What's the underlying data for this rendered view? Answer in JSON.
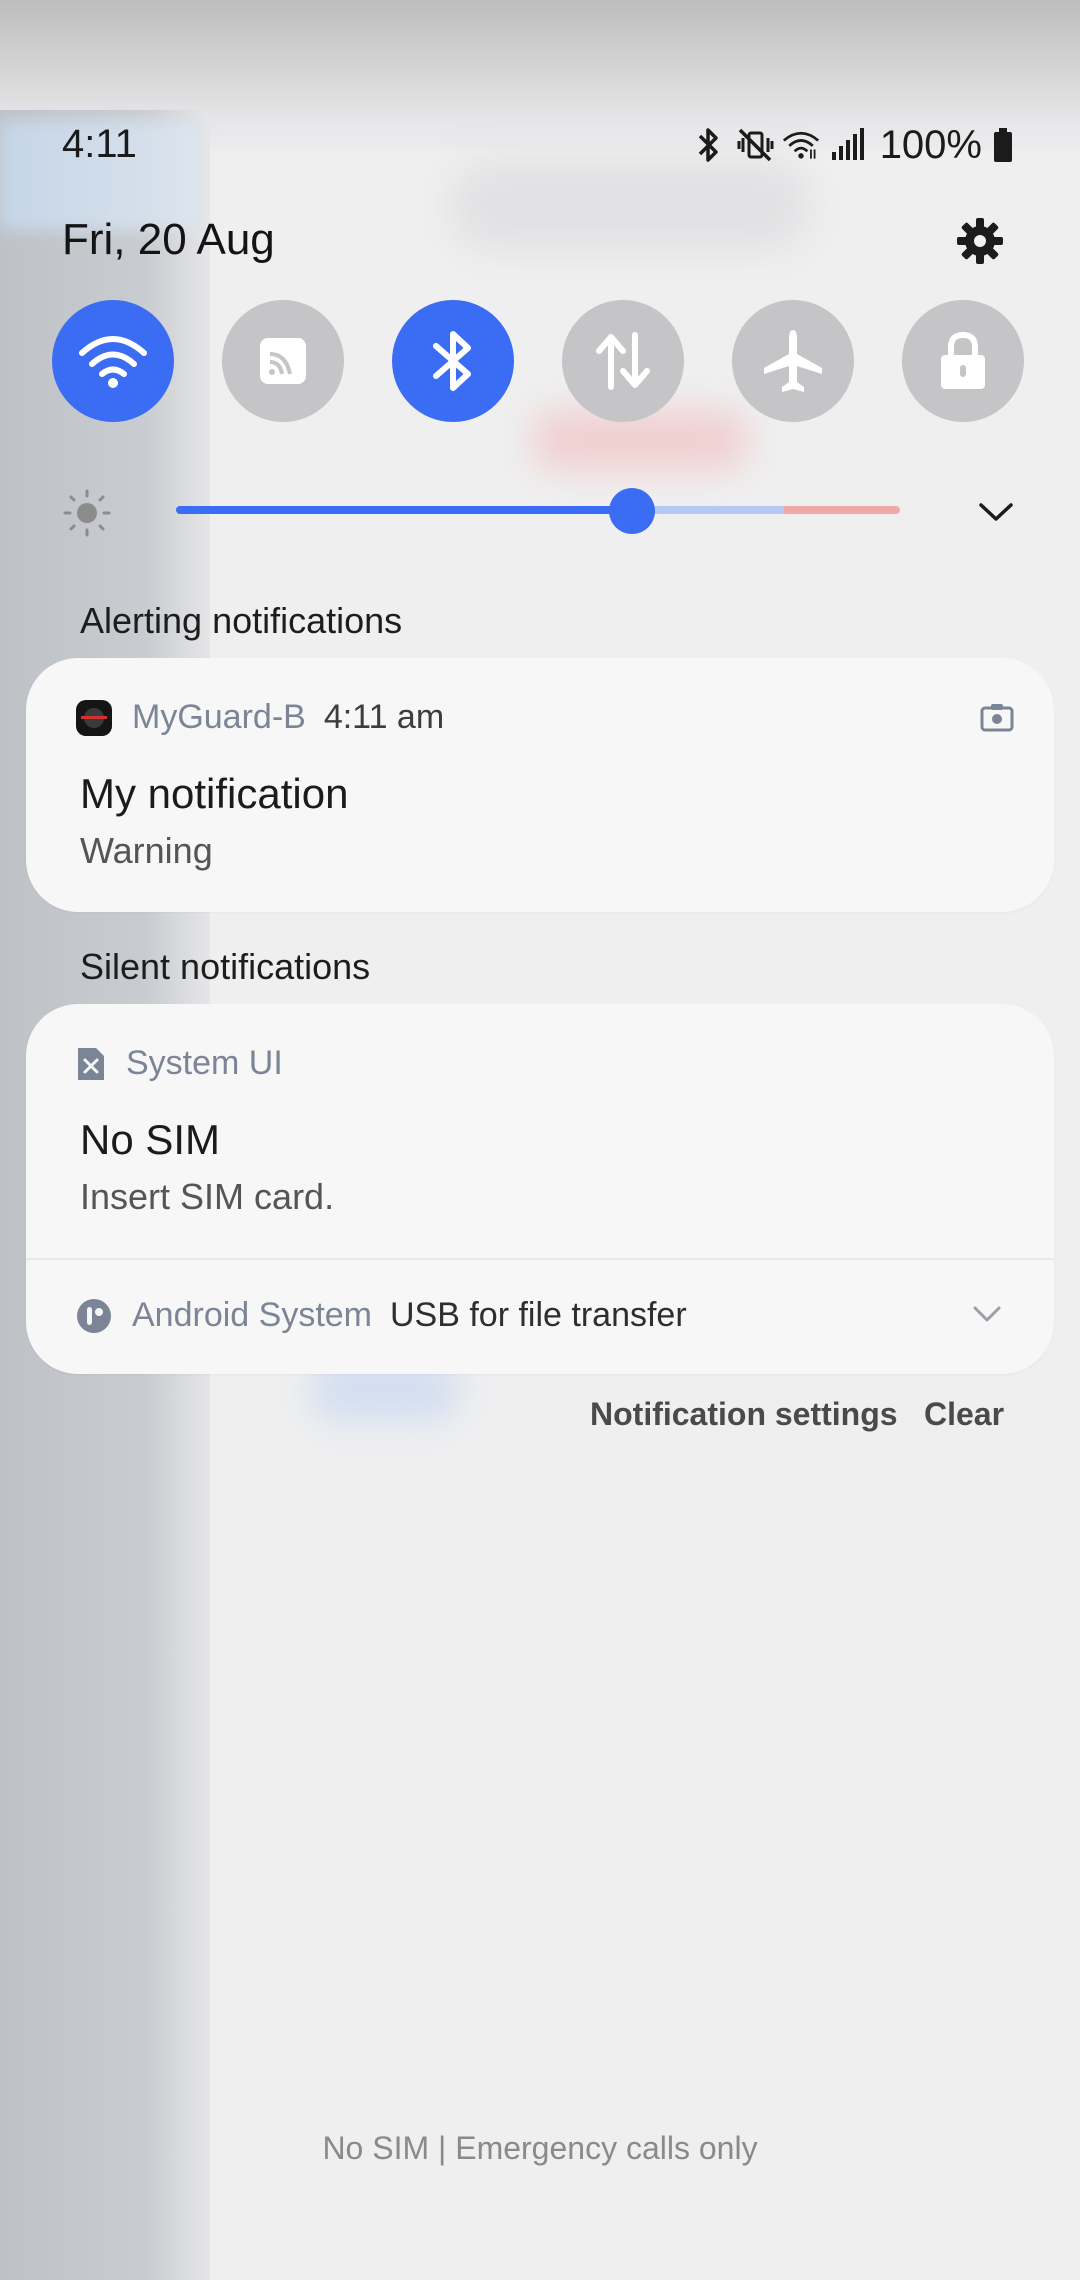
{
  "status_bar": {
    "time": "4:11",
    "battery_percent": "100%",
    "icons": [
      "bluetooth-icon",
      "vibrate-mute-icon",
      "wifi-icon",
      "cell-signal-icon",
      "battery-icon"
    ]
  },
  "header": {
    "date": "Fri, 20 Aug",
    "settings_icon": "gear-icon"
  },
  "quick_toggles": [
    {
      "name": "wifi",
      "icon": "wifi-icon",
      "on": true
    },
    {
      "name": "nfc",
      "icon": "nfc-icon",
      "on": false
    },
    {
      "name": "bluetooth",
      "icon": "bluetooth-icon",
      "on": true
    },
    {
      "name": "mobile-data",
      "icon": "data-transfer-icon",
      "on": false
    },
    {
      "name": "airplane-mode",
      "icon": "airplane-icon",
      "on": false
    },
    {
      "name": "lock",
      "icon": "lock-icon",
      "on": false
    }
  ],
  "brightness": {
    "level": 0.63
  },
  "sections": {
    "alerting_title": "Alerting notifications",
    "silent_title": "Silent notifications"
  },
  "alerting": {
    "app_name": "MyGuard-B",
    "time": "4:11 am",
    "title": "My notification",
    "text": "Warning"
  },
  "silent": {
    "app_name": "System UI",
    "title": "No SIM",
    "text": "Insert SIM card.",
    "collapsed_app_name": "Android System",
    "collapsed_text": "USB for file transfer"
  },
  "actions": {
    "settings_label": "Notification settings",
    "clear_label": "Clear"
  },
  "footer": {
    "carrier_text": "No SIM | Emergency calls only"
  },
  "colors": {
    "accent": "#3a6cf4",
    "toggle_off": "#c5c5c7",
    "card_bg": "#f7f7f8"
  }
}
